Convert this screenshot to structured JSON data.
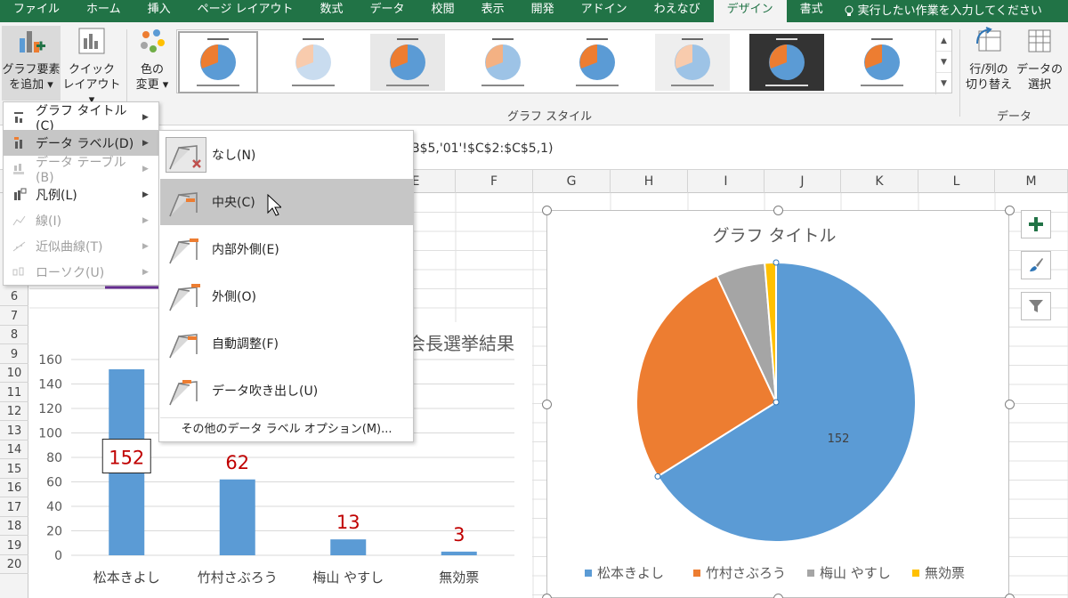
{
  "tabs": [
    "ファイル",
    "ホーム",
    "挿入",
    "ページ レイアウト",
    "数式",
    "データ",
    "校閲",
    "表示",
    "開発",
    "アドイン",
    "わえなび",
    "デザイン",
    "書式"
  ],
  "active_tab": "デザイン",
  "tell_me": "実行したい作業を入力してください",
  "ribbon": {
    "add_element": [
      "グラフ要素",
      "を追加 ▾"
    ],
    "quick_layout": [
      "クイック",
      "レイアウト ▾"
    ],
    "change_color": [
      "色の",
      "変更 ▾"
    ],
    "chart_style_label": "グラフ スタイル",
    "switch_row_col": [
      "行/列の",
      "切り替え"
    ],
    "select_data": [
      "データの",
      "選択"
    ],
    "data_label": "データ"
  },
  "formula_text": "B$5,'01'!$C$2:$C$5,1)",
  "columns": [
    "E",
    "F",
    "G",
    "H",
    "I",
    "J",
    "K",
    "L",
    "M"
  ],
  "rows": [
    "6",
    "7",
    "8",
    "9",
    "10",
    "11",
    "12",
    "13",
    "14",
    "15",
    "16",
    "17",
    "18",
    "19",
    "20"
  ],
  "menu1": [
    {
      "label": "グラフ タイトル(C)",
      "state": "normal",
      "icon": "chart-title-icon"
    },
    {
      "label": "データ ラベル(D)",
      "state": "highlight",
      "icon": "data-labels-icon"
    },
    {
      "label": "データ テーブル(B)",
      "state": "disabled",
      "icon": "data-table-icon"
    },
    {
      "label": "凡例(L)",
      "state": "normal",
      "icon": "legend-icon"
    },
    {
      "label": "線(I)",
      "state": "disabled",
      "icon": "lines-icon"
    },
    {
      "label": "近似曲線(T)",
      "state": "disabled",
      "icon": "trendline-icon"
    },
    {
      "label": "ローソク(U)",
      "state": "disabled",
      "icon": "up-down-bars-icon"
    }
  ],
  "menu2": [
    {
      "label": "なし(N)",
      "state": "normal",
      "icon": "none-label-icon"
    },
    {
      "label": "中央(C)",
      "state": "highlight",
      "icon": "center-label-icon"
    },
    {
      "label": "内部外側(E)",
      "state": "normal",
      "icon": "inside-end-label-icon"
    },
    {
      "label": "外側(O)",
      "state": "normal",
      "icon": "outside-end-label-icon"
    },
    {
      "label": "自動調整(F)",
      "state": "normal",
      "icon": "best-fit-label-icon"
    },
    {
      "label": "データ吹き出し(U)",
      "state": "normal",
      "icon": "data-callout-label-icon"
    }
  ],
  "menu2_more": "その他のデータ ラベル オプション(M)...",
  "colors": {
    "excel_green": "#217346",
    "blue": "#5b9bd5",
    "orange": "#ed7d31",
    "gray": "#a5a5a5",
    "yellow": "#ffc000",
    "red_label": "#c00000"
  },
  "chart_data": [
    {
      "type": "bar",
      "title": "会長選挙結果",
      "categories": [
        "松本きよし",
        "竹村さぶろう",
        "梅山 やすし",
        "無効票"
      ],
      "values": [
        152,
        62,
        13,
        3
      ],
      "value_labels": [
        "152",
        "62",
        "13",
        "3"
      ],
      "ylim": [
        0,
        160
      ],
      "yticks": [
        "0",
        "20",
        "40",
        "60",
        "80",
        "100",
        "120",
        "140",
        "160"
      ],
      "grid": true
    },
    {
      "type": "pie",
      "title": "グラフ タイトル",
      "categories": [
        "松本きよし",
        "竹村さぶろう",
        "梅山 やすし",
        "無効票"
      ],
      "values": [
        152,
        62,
        13,
        3
      ],
      "value_labels": [
        "152"
      ],
      "legend": "bottom"
    }
  ]
}
